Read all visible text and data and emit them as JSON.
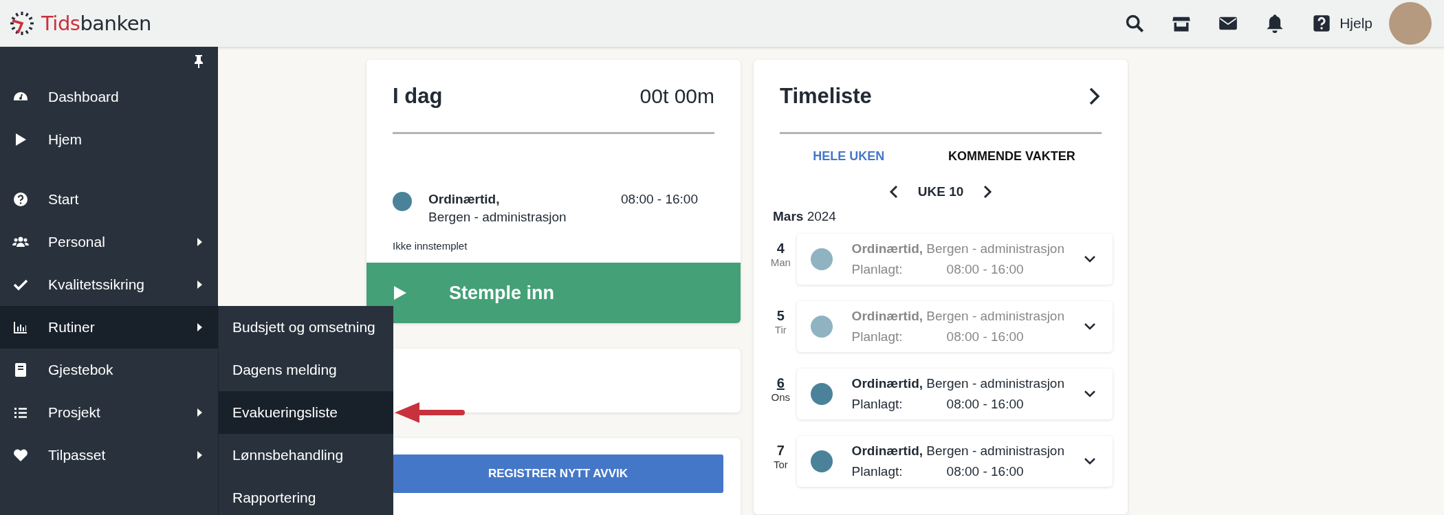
{
  "header": {
    "logo": {
      "brand_red": "Tids",
      "brand_dark": "banken"
    },
    "help": "Hjelp"
  },
  "sidebar": {
    "groups": [
      [
        {
          "label": "Dashboard",
          "has_submenu": false,
          "selected": false
        },
        {
          "label": "Hjem",
          "has_submenu": false,
          "selected": false
        }
      ],
      [
        {
          "label": "Start",
          "has_submenu": false,
          "selected": false
        },
        {
          "label": "Personal",
          "has_submenu": true,
          "selected": false
        },
        {
          "label": "Kvalitetssikring",
          "has_submenu": true,
          "selected": false
        },
        {
          "label": "Rutiner",
          "has_submenu": true,
          "selected": true,
          "submenu": [
            {
              "label": "Budsjett og omsetning",
              "selected": false
            },
            {
              "label": "Dagens melding",
              "selected": false
            },
            {
              "label": "Evakueringsliste",
              "selected": true
            },
            {
              "label": "Lønnsbehandling",
              "selected": false
            },
            {
              "label": "Rapportering",
              "selected": false
            }
          ]
        },
        {
          "label": "Gjestebok",
          "has_submenu": false,
          "selected": false
        },
        {
          "label": "Prosjekt",
          "has_submenu": true,
          "selected": false
        },
        {
          "label": "Tilpasset",
          "has_submenu": true,
          "selected": false
        }
      ]
    ]
  },
  "today_card": {
    "title": "I dag",
    "total": "00t 00m",
    "shift": {
      "type": "Ordinærtid,",
      "place": "Bergen - administrasjon",
      "time": "08:00 - 16:00"
    },
    "status": "Ikke innstemplet",
    "button": "Stemple inn"
  },
  "deviation_card": {
    "button": "REGISTRER NYTT AVVIK"
  },
  "timesheet": {
    "title": "Timeliste",
    "tabs": [
      {
        "label": "HELE UKEN",
        "selected": true
      },
      {
        "label": "KOMMENDE VAKTER",
        "selected": false
      }
    ],
    "week": "UKE 10",
    "month": "Mars",
    "year": "2024",
    "days": [
      {
        "day": "4",
        "weekday": "Man",
        "past": true,
        "today": false,
        "type": "Ordinærtid,",
        "place": "Bergen - administrasjon",
        "planned_label": "Planlagt:",
        "time": "08:00 - 16:00"
      },
      {
        "day": "5",
        "weekday": "Tir",
        "past": true,
        "today": false,
        "type": "Ordinærtid,",
        "place": "Bergen - administrasjon",
        "planned_label": "Planlagt:",
        "time": "08:00 - 16:00"
      },
      {
        "day": "6",
        "weekday": "Ons",
        "past": false,
        "today": true,
        "type": "Ordinærtid,",
        "place": "Bergen - administrasjon",
        "planned_label": "Planlagt:",
        "time": "08:00 - 16:00"
      },
      {
        "day": "7",
        "weekday": "Tor",
        "past": false,
        "today": false,
        "type": "Ordinærtid,",
        "place": "Bergen - administrasjon",
        "planned_label": "Planlagt:",
        "time": "08:00 - 16:00"
      }
    ]
  }
}
